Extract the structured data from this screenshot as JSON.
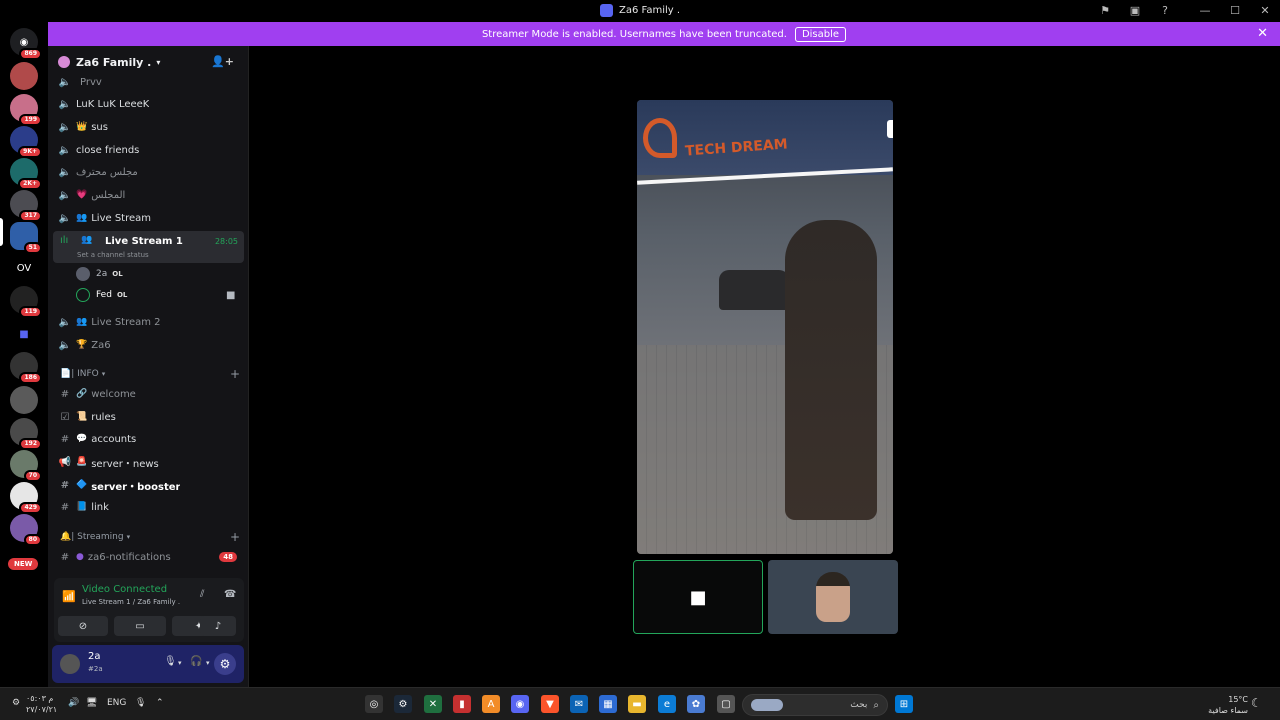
{
  "window": {
    "title": "Za6 Family ."
  },
  "banner": {
    "text": "Streamer Mode is enabled. Usernames have been truncated.",
    "button": "Disable"
  },
  "rail": {
    "badges": [
      "869",
      "199",
      "9K+",
      "2K+",
      "317",
      "51",
      "119",
      "186",
      "192",
      "70",
      "429",
      "80"
    ],
    "ov_label": "OV",
    "new_label": "NEW"
  },
  "sidebar": {
    "guild_name": "Za6 Family .",
    "channels": [
      {
        "label": "Prvv",
        "icon": "voice",
        "emoji": ""
      },
      {
        "label": "LuK LuK LeeeK",
        "icon": "voice",
        "emoji": ""
      },
      {
        "label": "sus",
        "icon": "voice",
        "emoji": "👑"
      },
      {
        "label": "close friends",
        "icon": "voice",
        "emoji": ""
      },
      {
        "label": "مجلس محترف",
        "icon": "voice",
        "emoji": ""
      },
      {
        "label": "المجلس",
        "icon": "voice",
        "emoji": "💗"
      },
      {
        "label": "Live Stream",
        "icon": "voice",
        "emoji": "👥"
      }
    ],
    "active_channel": {
      "name": "Live Stream 1",
      "time": "28:05",
      "status": "Set a channel status"
    },
    "voice_users": [
      {
        "name": "2a",
        "tag": "OL"
      },
      {
        "name": "Fed",
        "tag": "OL"
      }
    ],
    "channels_after": [
      {
        "label": "Live Stream 2",
        "emoji": "👥"
      },
      {
        "label": "Za6",
        "emoji": "🏆"
      }
    ],
    "info_category": "| INFO",
    "info_channels": [
      {
        "label": "welcome",
        "emoji": "🔗"
      },
      {
        "label": "rules",
        "emoji": "📜"
      },
      {
        "label": "accounts",
        "emoji": "💬"
      },
      {
        "label": "server・news",
        "emoji": "🚨"
      },
      {
        "label": "server・booster",
        "emoji": "🔷"
      },
      {
        "label": "link",
        "emoji": "📘"
      }
    ],
    "streaming_category": "| Streaming",
    "streaming_channels": [
      {
        "label": "za6-notifications",
        "badge": "48"
      }
    ]
  },
  "voice_panel": {
    "status": "Video Connected",
    "location": "Live Stream 1 / Za6 Family ."
  },
  "user_panel": {
    "username": "2a",
    "status": "#2a"
  },
  "stage": {
    "sign_text": "TECH DREAM"
  },
  "taskbar": {
    "time": "م ٠٥:٠٣",
    "date": "٢٧/٠٧/٢١",
    "lang": "ENG",
    "search_placeholder": "بحث",
    "temp": "15°C",
    "weather": "سماء صافية"
  }
}
